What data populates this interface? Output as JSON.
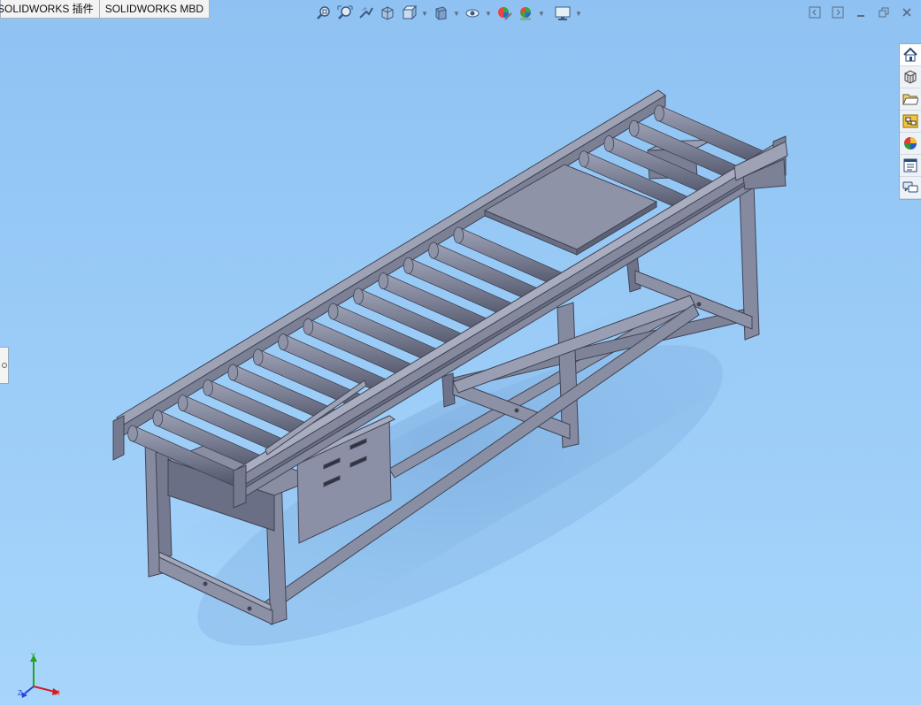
{
  "tabs": [
    {
      "label": "SOLIDWORKS 插件"
    },
    {
      "label": "SOLIDWORKS MBD"
    }
  ],
  "heads_up_toolbar": [
    {
      "icon": "zoom-to-fit-icon"
    },
    {
      "icon": "zoom-to-area-icon"
    },
    {
      "icon": "previous-view-icon"
    },
    {
      "icon": "section-view-icon"
    },
    {
      "icon": "view-orientation-icon",
      "dropdown": true
    },
    {
      "icon": "display-style-icon",
      "dropdown": true
    },
    {
      "icon": "hide-show-items-icon",
      "dropdown": true
    },
    {
      "icon": "edit-appearance-icon"
    },
    {
      "icon": "apply-scene-icon",
      "dropdown": true
    },
    {
      "icon": "view-settings-icon",
      "dropdown": true
    }
  ],
  "window_controls": [
    {
      "icon": "tile-left-icon"
    },
    {
      "icon": "tile-right-icon"
    },
    {
      "icon": "minimize-icon"
    },
    {
      "icon": "restore-icon"
    },
    {
      "icon": "close-icon"
    }
  ],
  "task_pane": [
    {
      "icon": "home-icon"
    },
    {
      "icon": "design-library-icon"
    },
    {
      "icon": "file-explorer-icon"
    },
    {
      "icon": "view-palette-icon"
    },
    {
      "icon": "appearances-icon"
    },
    {
      "icon": "custom-properties-icon"
    },
    {
      "icon": "forum-icon"
    }
  ],
  "triad": {
    "x": "X",
    "y": "Y",
    "z": "Z"
  },
  "colors": {
    "background": "#97c8f5",
    "model_metal": "#8a8ea3",
    "model_dark": "#5e6276",
    "axis_x": "#d21f1f",
    "axis_y": "#23a323",
    "axis_z": "#2a3fd6"
  }
}
